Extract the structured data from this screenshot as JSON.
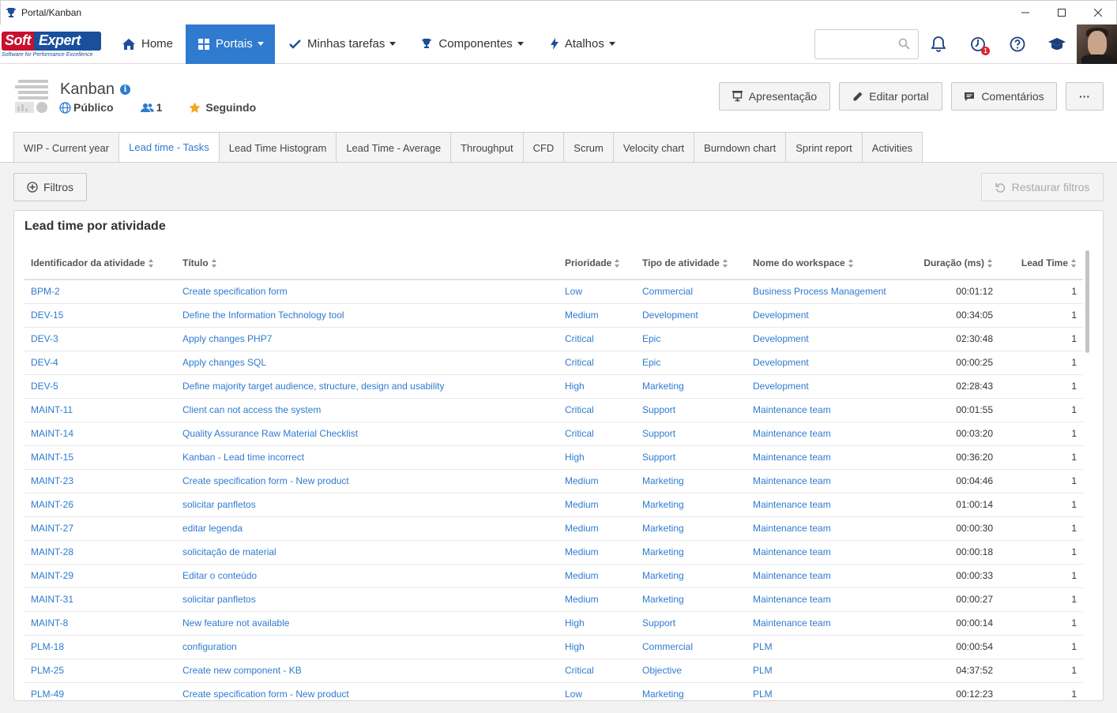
{
  "window": {
    "title": "Portal/Kanban"
  },
  "nav": {
    "logo_soft": "Soft",
    "logo_expert": "Expert",
    "logo_tagline": "Software for Performance Excellence",
    "items": [
      {
        "label": "Home"
      },
      {
        "label": "Portais"
      },
      {
        "label": "Minhas tarefas"
      },
      {
        "label": "Componentes"
      },
      {
        "label": "Atalhos"
      }
    ],
    "search_placeholder": "",
    "notification_badge": "1"
  },
  "portal": {
    "title": "Kanban",
    "visibility": "Público",
    "members": "1",
    "follow": "Seguindo",
    "buttons": {
      "presentation": "Apresentação",
      "edit": "Editar portal",
      "comments": "Comentários",
      "more": "···"
    }
  },
  "tabs": [
    {
      "label": "WIP - Current year"
    },
    {
      "label": "Lead time - Tasks"
    },
    {
      "label": "Lead Time Histogram"
    },
    {
      "label": "Lead Time - Average"
    },
    {
      "label": "Throughput"
    },
    {
      "label": "CFD"
    },
    {
      "label": "Scrum"
    },
    {
      "label": "Velocity chart"
    },
    {
      "label": "Burndown chart"
    },
    {
      "label": "Sprint report"
    },
    {
      "label": "Activities"
    }
  ],
  "filters": {
    "label": "Filtros",
    "restore": "Restaurar filtros"
  },
  "panel": {
    "title": "Lead time por atividade",
    "columns": [
      "Identificador da atividade",
      "Título",
      "Prioridade",
      "Tipo de atividade",
      "Nome do workspace",
      "Duração (ms)",
      "Lead Time"
    ],
    "rows": [
      [
        "BPM-2",
        "Create specification form",
        "Low",
        "Commercial",
        "Business Process Management",
        "00:01:12",
        "1"
      ],
      [
        "DEV-15",
        "Define the Information Technology tool",
        "Medium",
        "Development",
        "Development",
        "00:34:05",
        "1"
      ],
      [
        "DEV-3",
        "Apply changes PHP7",
        "Critical",
        "Epic",
        "Development",
        "02:30:48",
        "1"
      ],
      [
        "DEV-4",
        "Apply changes SQL",
        "Critical",
        "Epic",
        "Development",
        "00:00:25",
        "1"
      ],
      [
        "DEV-5",
        "Define majority target audience, structure, design and usability",
        "High",
        "Marketing",
        "Development",
        "02:28:43",
        "1"
      ],
      [
        "MAINT-11",
        "Client can not access the system",
        "Critical",
        "Support",
        "Maintenance team",
        "00:01:55",
        "1"
      ],
      [
        "MAINT-14",
        "Quality Assurance Raw Material Checklist",
        "Critical",
        "Support",
        "Maintenance team",
        "00:03:20",
        "1"
      ],
      [
        "MAINT-15",
        "Kanban - Lead time incorrect",
        "High",
        "Support",
        "Maintenance team",
        "00:36:20",
        "1"
      ],
      [
        "MAINT-23",
        "Create specification form - New product",
        "Medium",
        "Marketing",
        "Maintenance team",
        "00:04:46",
        "1"
      ],
      [
        "MAINT-26",
        "solicitar panfletos",
        "Medium",
        "Marketing",
        "Maintenance team",
        "01:00:14",
        "1"
      ],
      [
        "MAINT-27",
        "editar legenda",
        "Medium",
        "Marketing",
        "Maintenance team",
        "00:00:30",
        "1"
      ],
      [
        "MAINT-28",
        "solicitação de material",
        "Medium",
        "Marketing",
        "Maintenance team",
        "00:00:18",
        "1"
      ],
      [
        "MAINT-29",
        "Editar o conteúdo",
        "Medium",
        "Marketing",
        "Maintenance team",
        "00:00:33",
        "1"
      ],
      [
        "MAINT-31",
        "solicitar panfletos",
        "Medium",
        "Marketing",
        "Maintenance team",
        "00:00:27",
        "1"
      ],
      [
        "MAINT-8",
        "New feature not available",
        "High",
        "Support",
        "Maintenance team",
        "00:00:14",
        "1"
      ],
      [
        "PLM-18",
        "configuration",
        "High",
        "Commercial",
        "PLM",
        "00:00:54",
        "1"
      ],
      [
        "PLM-25",
        "Create new component - KB",
        "Critical",
        "Objective",
        "PLM",
        "04:37:52",
        "1"
      ],
      [
        "PLM-49",
        "Create specification form - New product",
        "Low",
        "Marketing",
        "PLM",
        "00:12:23",
        "1"
      ]
    ]
  }
}
